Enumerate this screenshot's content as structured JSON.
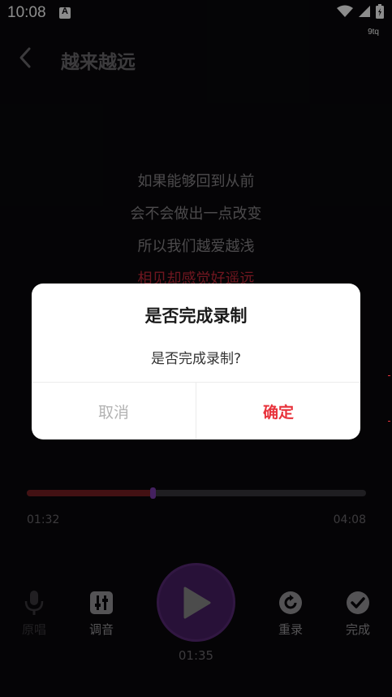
{
  "status_bar": {
    "time": "10:08",
    "carrier": "9tq"
  },
  "header": {
    "title": "越来越远"
  },
  "lyrics": [
    "如果能够回到从前",
    "会不会做出一点改变",
    "所以我们越爱越浅",
    "相见却感觉好遥远"
  ],
  "player": {
    "current_time": "01:32",
    "total_time": "04:08",
    "progress_percent": 37,
    "play_time": "01:35"
  },
  "controls": {
    "original_label": "原唱",
    "tune_label": "调音",
    "rerecord_label": "重录",
    "finish_label": "完成"
  },
  "dialog": {
    "title": "是否完成录制",
    "message": "是否完成录制?",
    "cancel_label": "取消",
    "confirm_label": "确定"
  },
  "colors": {
    "accent": "#e8333c",
    "progress_fill": "#7a1f24",
    "play_button": "#4a1f66"
  }
}
